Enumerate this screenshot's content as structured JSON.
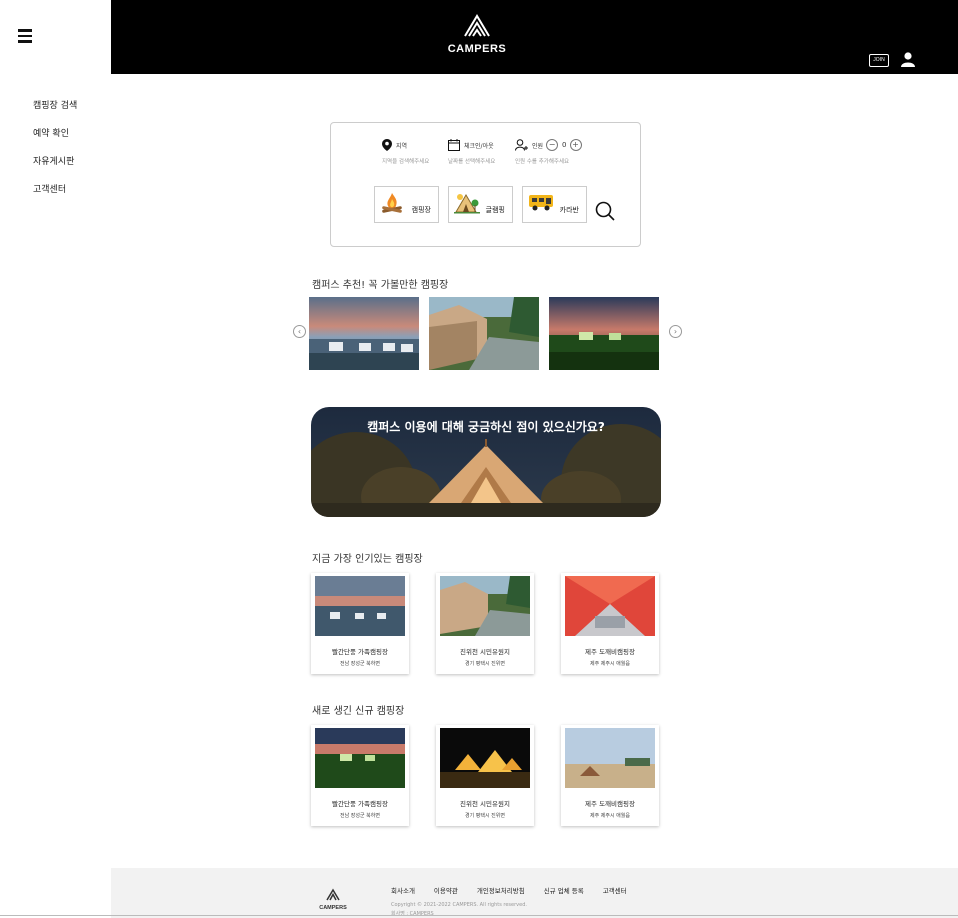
{
  "sidebar": {
    "items": [
      {
        "label": "캠핑장 검색"
      },
      {
        "label": "예약 확인"
      },
      {
        "label": "자유게시판"
      },
      {
        "label": "고객센터"
      }
    ]
  },
  "header": {
    "logo_text": "CAMPERS",
    "join_label": "JOIN"
  },
  "search": {
    "region_label": "지역",
    "region_hint": "지역을 검색해주세요",
    "date_label": "체크인/아웃",
    "date_hint": "날짜를 선택해주세요",
    "people_label": "인원",
    "people_count": "0",
    "people_hint": "인원 수를 추가해주세요",
    "minus_symbol": "−",
    "plus_symbol": "+",
    "types": [
      {
        "label": "캠핑장"
      },
      {
        "label": "글램핑"
      },
      {
        "label": "카라반"
      }
    ]
  },
  "recommend": {
    "title": "캠퍼스 추천! 꼭 가볼만한 캠핑장",
    "prev_symbol": "‹",
    "next_symbol": "›"
  },
  "banner": {
    "text": "캠퍼스 이용에 대해 궁금하신 점이 있으신가요?"
  },
  "popular": {
    "title": "지금 가장 인기있는 캠핑장",
    "cards": [
      {
        "name": "빨간단풍 가족캠핑장",
        "location": "전남 장성군 북하면"
      },
      {
        "name": "진위천 시민유원지",
        "location": "경기 평택시 진위면"
      },
      {
        "name": "제주 도깨비캠핑장",
        "location": "제주 제주시 애월읍"
      }
    ]
  },
  "new_sites": {
    "title": "새로 생긴 신규 캠핑장",
    "cards": [
      {
        "name": "빨간단풍 가족캠핑장",
        "location": "전남 장성군 북하면"
      },
      {
        "name": "진위천 시민유원지",
        "location": "경기 평택시 진위면"
      },
      {
        "name": "제주 도깨비캠핑장",
        "location": "제주 제주시 애월읍"
      }
    ]
  },
  "footer": {
    "logo_text": "CAMPERS",
    "links": [
      {
        "label": "회사소개"
      },
      {
        "label": "이용약관"
      },
      {
        "label": "개인정보처리방침"
      },
      {
        "label": "신규 업체 등록"
      },
      {
        "label": "고객센터"
      }
    ],
    "copyright": "Copyright © 2021-2022 CAMPERS. All rights reserved.",
    "info": "회사명 : CAMPERS"
  },
  "colors": {
    "header_bg": "#000000",
    "footer_bg": "#f2f2f2",
    "card_border": "#cccccc"
  }
}
